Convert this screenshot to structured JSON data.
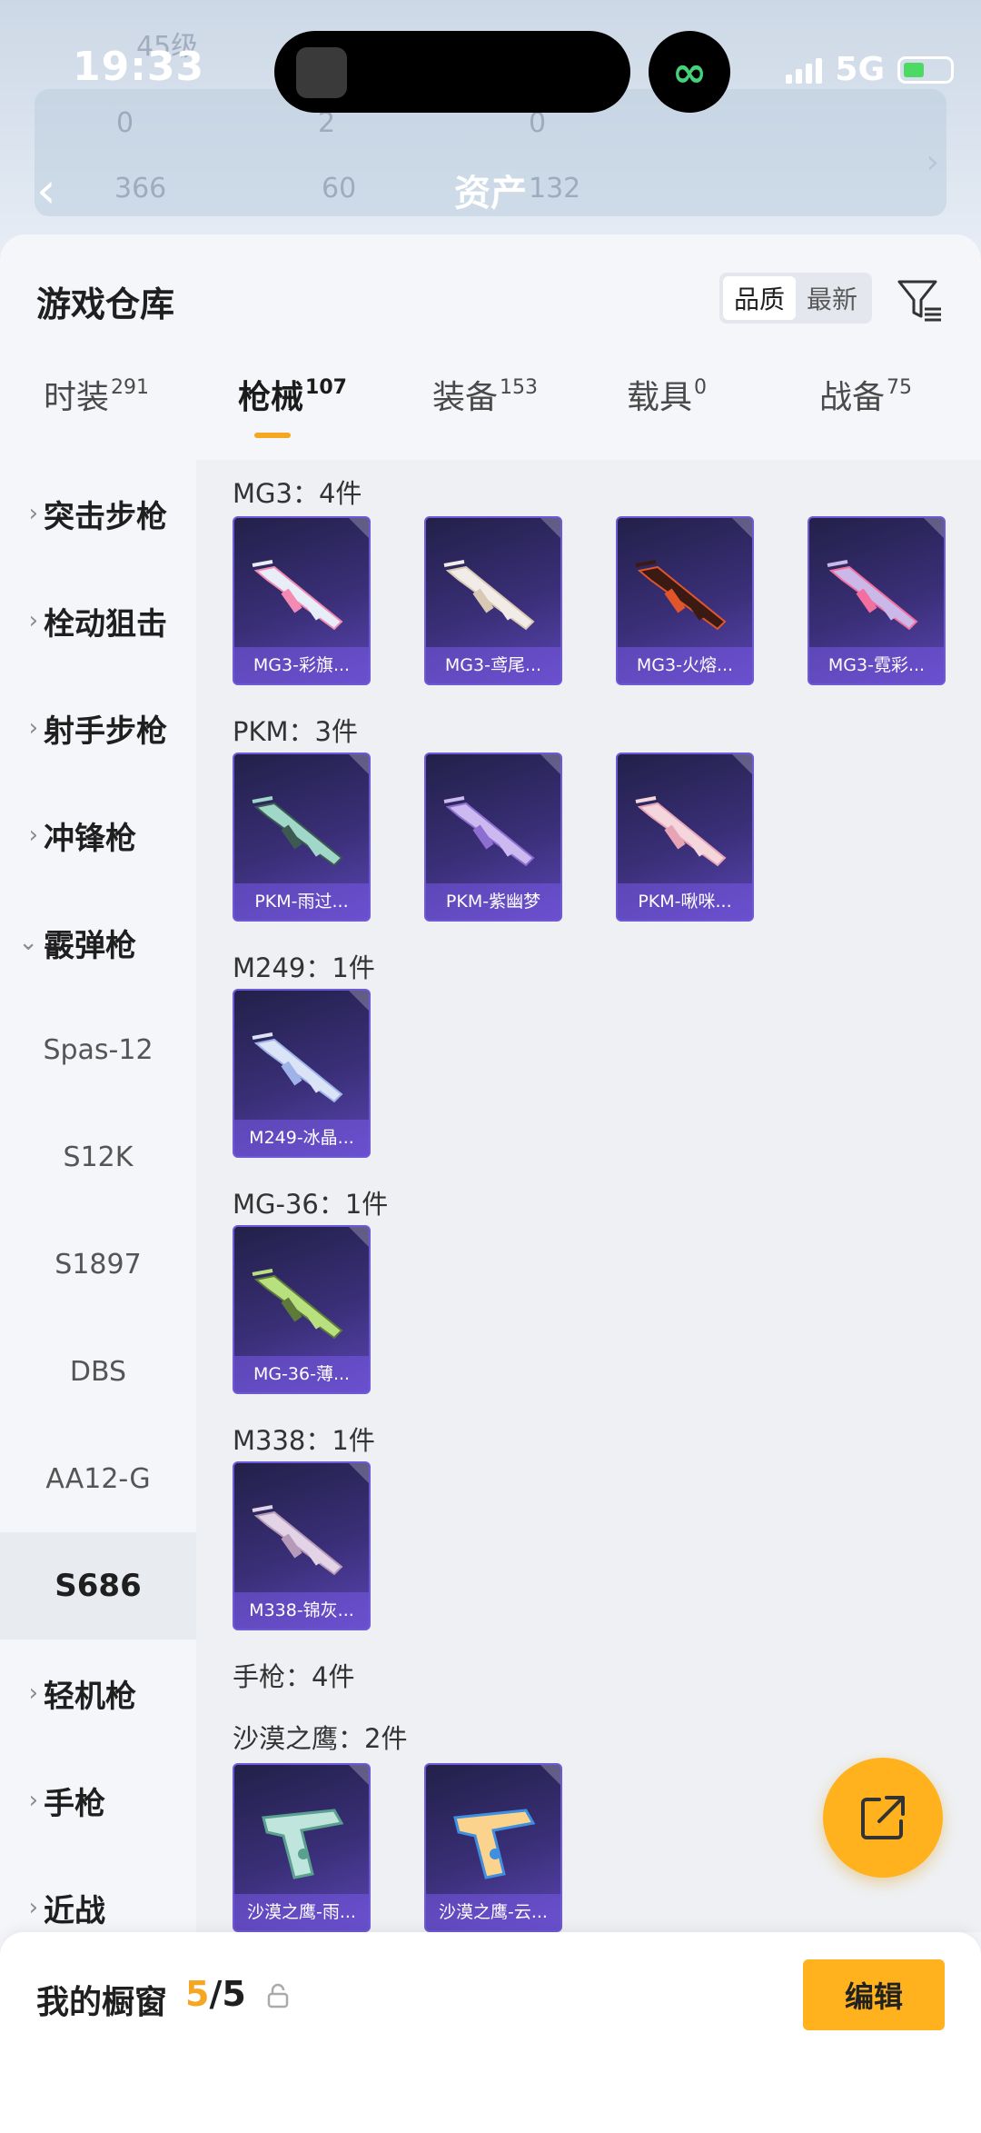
{
  "status_bar": {
    "time": "19:33",
    "network": "5G"
  },
  "background_header": {
    "level_text": "45级",
    "stat_1": "0",
    "stat_2": "2",
    "stat_3": "0",
    "stat_4": "366",
    "stat_5": "60",
    "stat_6": "132",
    "title": "资产"
  },
  "sheet": {
    "title": "游戏仓库",
    "sort_options": [
      "品质",
      "最新"
    ],
    "active_sort": "品质"
  },
  "tabs": [
    {
      "label": "时装",
      "count": "291"
    },
    {
      "label": "枪械",
      "count": "107",
      "active": true
    },
    {
      "label": "装备",
      "count": "153"
    },
    {
      "label": "载具",
      "count": "0"
    },
    {
      "label": "战备",
      "count": "75"
    }
  ],
  "sidebar": {
    "categories": [
      "突击步枪",
      "栓动狙击",
      "射手步枪",
      "冲锋枪",
      "霰弹枪"
    ],
    "shotgun_subitems": [
      "Spas-12",
      "S12K",
      "S1897",
      "DBS",
      "AA12-G",
      "S686"
    ],
    "selected_sub": "S686",
    "more_categories": [
      "轻机枪",
      "手枪",
      "近战"
    ]
  },
  "groups": [
    {
      "title": "MG3：4件",
      "items": [
        {
          "name": "MG3-彩旗...",
          "tint": "#e8eef8",
          "accent": "#f28ab2"
        },
        {
          "name": "MG3-鸢尾...",
          "tint": "#f2ece8",
          "accent": "#d9c8b4"
        },
        {
          "name": "MG3-火熔...",
          "tint": "#3a1a12",
          "accent": "#e0552a"
        },
        {
          "name": "MG3-霓彩...",
          "tint": "#c9b8e8",
          "accent": "#f26fa0"
        }
      ]
    },
    {
      "title": "PKM：3件",
      "items": [
        {
          "name": "PKM-雨过...",
          "tint": "#9fd8c9",
          "accent": "#3d5a52"
        },
        {
          "name": "PKM-紫幽梦",
          "tint": "#cbb9ef",
          "accent": "#8c6fd1"
        },
        {
          "name": "PKM-啾咪...",
          "tint": "#f5d6dd",
          "accent": "#e7a4b7"
        }
      ]
    },
    {
      "title": "M249：1件",
      "items": [
        {
          "name": "M249-冰晶...",
          "tint": "#dbe4f7",
          "accent": "#9fb3e8"
        }
      ]
    },
    {
      "title": "MG-36：1件",
      "items": [
        {
          "name": "MG-36-薄...",
          "tint": "#b9e07f",
          "accent": "#5e7a3a"
        }
      ]
    },
    {
      "title": "M338：1件",
      "items": [
        {
          "name": "M338-锦灰...",
          "tint": "#e3d3e6",
          "accent": "#b79ab9"
        }
      ]
    },
    {
      "title": "手枪：4件",
      "items": []
    },
    {
      "title": "沙漠之鹰：2件",
      "items": [
        {
          "name": "沙漠之鹰-雨...",
          "tint": "#bfe5dc",
          "accent": "#5aa08f"
        },
        {
          "name": "沙漠之鹰-云...",
          "tint": "#fbd38c",
          "accent": "#3f8fe0"
        }
      ]
    }
  ],
  "bottom_bar": {
    "label": "我的橱窗",
    "count_current": "5",
    "count_sep_total": "/5",
    "edit_label": "编辑"
  },
  "colors": {
    "accent": "#ffb21e",
    "tab_underline": "#f5a623",
    "card_border": "#6e5ad6"
  }
}
